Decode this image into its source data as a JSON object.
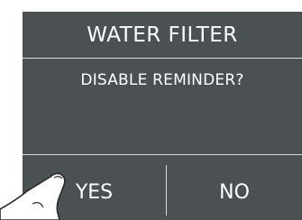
{
  "dialog": {
    "title": "WATER FILTER",
    "message": "DISABLE REMINDER?",
    "yes_label": "YES",
    "no_label": "NO"
  },
  "colors": {
    "panel_background": "#4b5152",
    "text": "#ffffff",
    "divider": "#d8dcdc"
  },
  "icons": {
    "pointer": "hand-pointer-icon"
  }
}
